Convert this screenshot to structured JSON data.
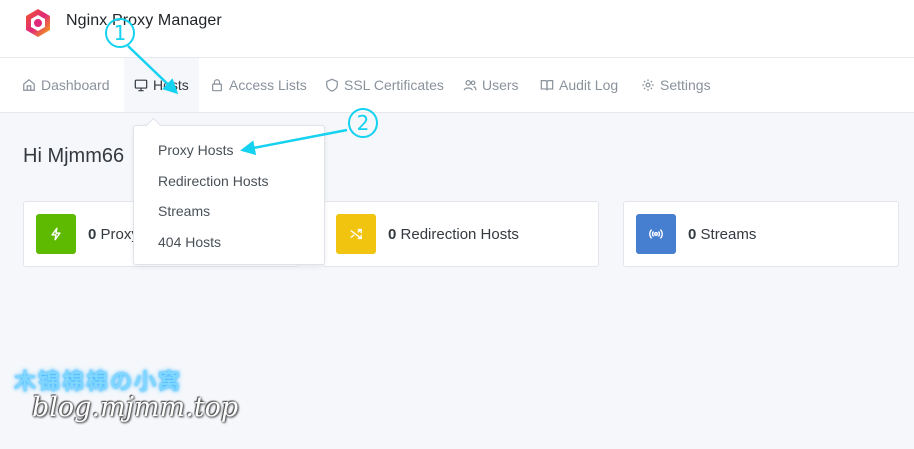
{
  "app": {
    "title": "Nginx Proxy Manager",
    "logo_icon": "hexagon-logo-icon"
  },
  "nav": {
    "items": [
      {
        "label": "Dashboard",
        "icon": "home-icon",
        "active": false
      },
      {
        "label": "Hosts",
        "icon": "monitor-icon",
        "active": true
      },
      {
        "label": "Access Lists",
        "icon": "lock-icon",
        "active": false
      },
      {
        "label": "SSL Certificates",
        "icon": "shield-icon",
        "active": false
      },
      {
        "label": "Users",
        "icon": "users-icon",
        "active": false
      },
      {
        "label": "Audit Log",
        "icon": "book-icon",
        "active": false
      },
      {
        "label": "Settings",
        "icon": "gear-icon",
        "active": false
      }
    ]
  },
  "greeting": "Hi Mjmm66",
  "hosts_menu": {
    "items": [
      "Proxy Hosts",
      "Redirection Hosts",
      "Streams",
      "404 Hosts"
    ]
  },
  "cards": [
    {
      "count": "0",
      "label": "Proxy",
      "icon": "lightning-icon",
      "color": "#5eba00"
    },
    {
      "count": "0",
      "label": "Redirection Hosts",
      "icon": "shuffle-icon",
      "color": "#f1c40f"
    },
    {
      "count": "0",
      "label": "Streams",
      "icon": "radio-icon",
      "color": "#467fcf"
    }
  ],
  "annotations": {
    "step1": "1",
    "step2": "2",
    "color": "#14d2f0"
  },
  "watermark": {
    "title": "木锦棉棉の小窝",
    "url": "blog.mjmm.top"
  }
}
